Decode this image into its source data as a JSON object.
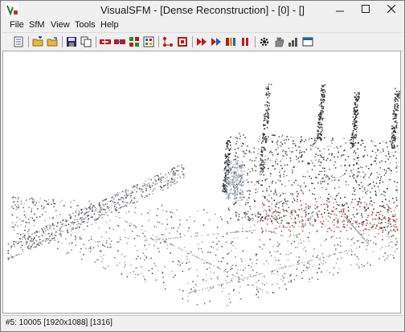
{
  "window": {
    "title": "VisualSFM - [Dense Reconstruction] - [0] - []",
    "app_icon": "visualsfm-logo-icon"
  },
  "menubar": {
    "items": [
      "File",
      "SfM",
      "View",
      "Tools",
      "Help"
    ]
  },
  "toolbar": {
    "buttons": [
      "notepad-icon",
      "open-folder-add-icon",
      "open-folder-icon",
      "save-icon",
      "copy-icon",
      "load-images-icon",
      "match-images-icon",
      "compute-matches-icon",
      "show-matches-icon",
      "branch-icon",
      "stop-icon",
      "sparse-3d-icon",
      "bundle-icon",
      "cmvs-icon",
      "pause-icon",
      "gear-icon",
      "hand-icon",
      "bar-chart-icon",
      "window-icon"
    ]
  },
  "statusbar": {
    "text": "#5: 10005 [1920x1088] [1316]"
  },
  "colors": {
    "window_bg": "#f0f0f0",
    "canvas_bg": "#ffffff",
    "accent_red": "#c01818",
    "accent_blue": "#1f5fbf"
  }
}
